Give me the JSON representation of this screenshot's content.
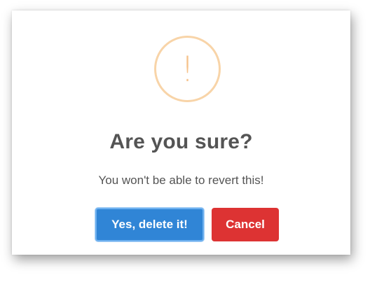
{
  "dialog": {
    "icon": "warning-icon",
    "icon_glyph": "!",
    "title": "Are you sure?",
    "message": "You won't be able to revert this!",
    "confirm_label": "Yes, delete it!",
    "cancel_label": "Cancel"
  },
  "colors": {
    "confirm": "#3085d6",
    "cancel": "#dd3333",
    "warning": "#f8bb86",
    "text": "#545454"
  }
}
